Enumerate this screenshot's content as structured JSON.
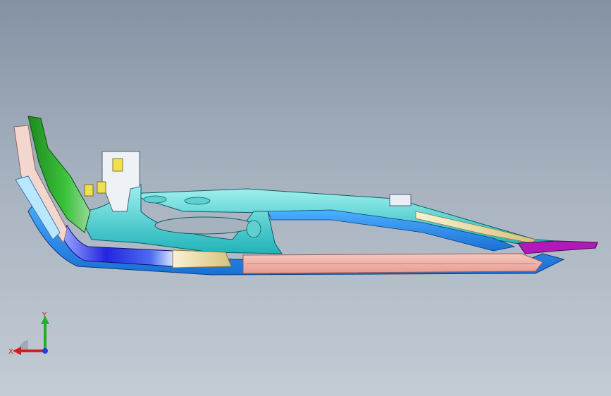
{
  "viewport": {
    "background_top": "#8492a3",
    "background_bottom": "#c3ccd5"
  },
  "model": {
    "colors": {
      "cyan_frame": "#2ec4c4",
      "cyan_light": "#7fe3e0",
      "blue_rail": "#1e90ff",
      "deep_blue": "#2020d8",
      "green_panel": "#2fa22f",
      "pink_strip": "#f1b1a8",
      "cream_panel": "#efe2b0",
      "magenta_tip": "#b01ab8",
      "white_bracket": "#eef2f7",
      "yellow_patch": "#f0e04a"
    }
  },
  "triad": {
    "x_label": "X",
    "y_label": "Y",
    "x_color": "#d0201a",
    "y_color": "#20b020",
    "z_color": "#2040e0"
  }
}
